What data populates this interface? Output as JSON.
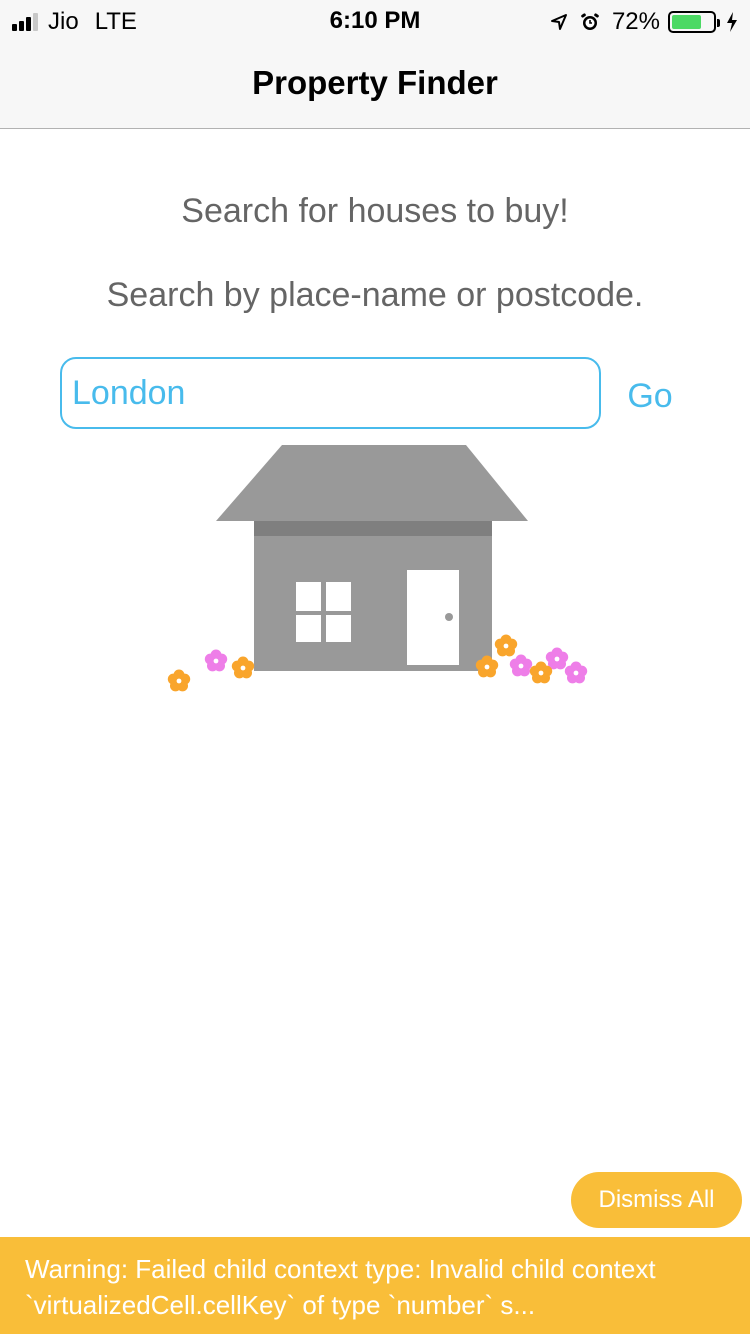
{
  "status_bar": {
    "carrier": "Jio",
    "network": "LTE",
    "time": "6:10 PM",
    "battery_percent": "72%",
    "battery_level": 0.72,
    "icons": [
      "signal-icon",
      "location-arrow-icon",
      "alarm-icon",
      "battery-icon",
      "charging-bolt-icon"
    ],
    "battery_color": "#4cd964"
  },
  "nav": {
    "title": "Property Finder"
  },
  "main": {
    "headline": "Search for houses to buy!",
    "subheadline": "Search by place-name or postcode.",
    "search": {
      "value": "London"
    },
    "go_label": "Go",
    "accent_color": "#48bbec",
    "illustration_icon": "house-illustration"
  },
  "dismiss_label": "Dismiss All",
  "warning": {
    "text": "Warning: Failed child context type: Invalid child context `virtualizedCell.cellKey` of type `number` s...",
    "color": "#f9be39"
  }
}
